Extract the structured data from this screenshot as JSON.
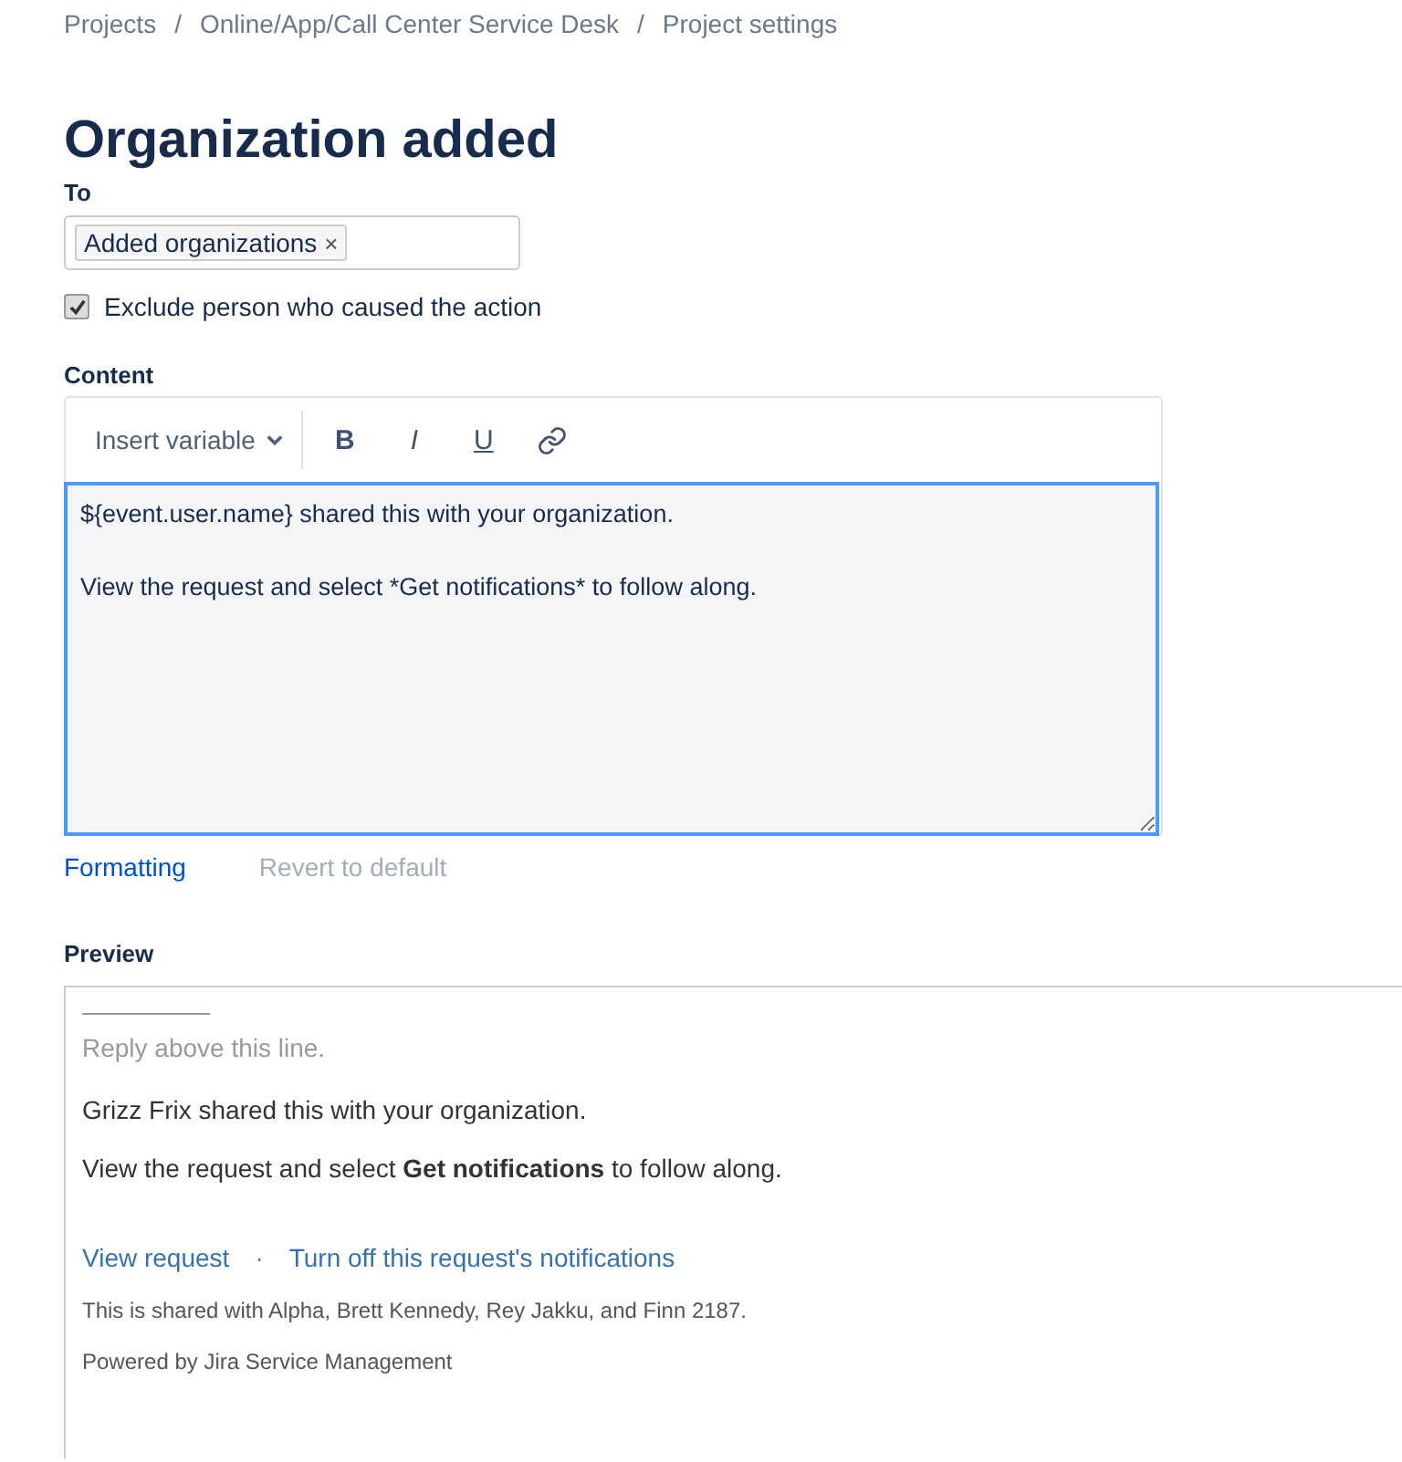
{
  "breadcrumbs": [
    "Projects",
    "Online/App/Call Center Service Desk",
    "Project settings"
  ],
  "breadcrumb_separator": "/",
  "title": "Organization added",
  "to": {
    "label": "To",
    "tags": [
      {
        "label": "Added organizations",
        "remove": "×"
      }
    ]
  },
  "exclude": {
    "label": "Exclude person who caused the action",
    "checked": true
  },
  "content": {
    "label": "Content",
    "insert_variable": "Insert variable",
    "format_buttons": [
      {
        "kind": "bold",
        "label": "B"
      },
      {
        "kind": "italic",
        "label": "I"
      },
      {
        "kind": "underline",
        "label": "U"
      },
      {
        "kind": "link"
      }
    ],
    "value": "${event.user.name} shared this with your organization.\n\nView the request and select *Get notifications* to follow along."
  },
  "actions": [
    {
      "label": "Formatting",
      "disabled": false
    },
    {
      "label": "Revert to default",
      "disabled": true
    }
  ],
  "preview": {
    "label": "Preview",
    "reply_line": "Reply above this line.",
    "paragraphs": [
      "Grizz Frix shared this with your organization.",
      "View the request and select **Get notifications** to follow along."
    ],
    "links": [
      "View request",
      "Turn off this request's notifications"
    ],
    "separator": "·",
    "shared_note": "This is shared with Alpha, Brett Kennedy, Rey Jakku, and Finn 2187.",
    "footer": "Powered by Jira Service Management"
  }
}
